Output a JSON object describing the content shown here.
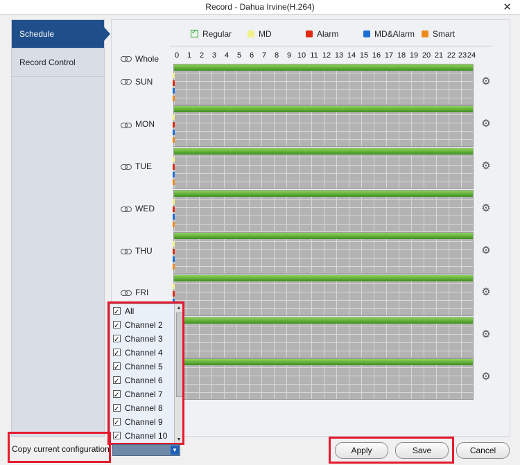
{
  "window": {
    "title": "Record - Dahua Irvine(H.264)",
    "close": "✕"
  },
  "sidebar": {
    "items": [
      {
        "label": "Schedule",
        "active": true
      },
      {
        "label": "Record Control",
        "active": false
      }
    ]
  },
  "legend": [
    {
      "label": "Regular",
      "color": "#2e9a2e",
      "icon": "check-box-icon"
    },
    {
      "label": "MD",
      "color": "#f3f18a"
    },
    {
      "label": "Alarm",
      "color": "#e02b12"
    },
    {
      "label": "MD&Alarm",
      "color": "#1d6fd6"
    },
    {
      "label": "Smart",
      "color": "#ee8a1b"
    }
  ],
  "schedule": {
    "whole_label": "Whole",
    "hours": [
      "0",
      "1",
      "2",
      "3",
      "4",
      "5",
      "6",
      "7",
      "8",
      "9",
      "10",
      "11",
      "12",
      "13",
      "14",
      "15",
      "16",
      "17",
      "18",
      "19",
      "20",
      "21",
      "22",
      "23",
      "24"
    ],
    "days": [
      "SUN",
      "MON",
      "TUE",
      "WED",
      "THU",
      "FRI",
      "",
      ""
    ],
    "colors": {
      "regular": "#4ea62a",
      "md": "#f3f18a",
      "alarm": "#e02b12",
      "md_alarm": "#1d6fd6",
      "smart": "#ee8a1b"
    }
  },
  "copy": {
    "label": "Copy current configuration to",
    "channels": [
      "All",
      "Channel 2",
      "Channel 3",
      "Channel 4",
      "Channel 5",
      "Channel 6",
      "Channel 7",
      "Channel 8",
      "Channel 9",
      "Channel 10"
    ]
  },
  "buttons": {
    "apply": "Apply",
    "save": "Save",
    "cancel": "Cancel"
  }
}
